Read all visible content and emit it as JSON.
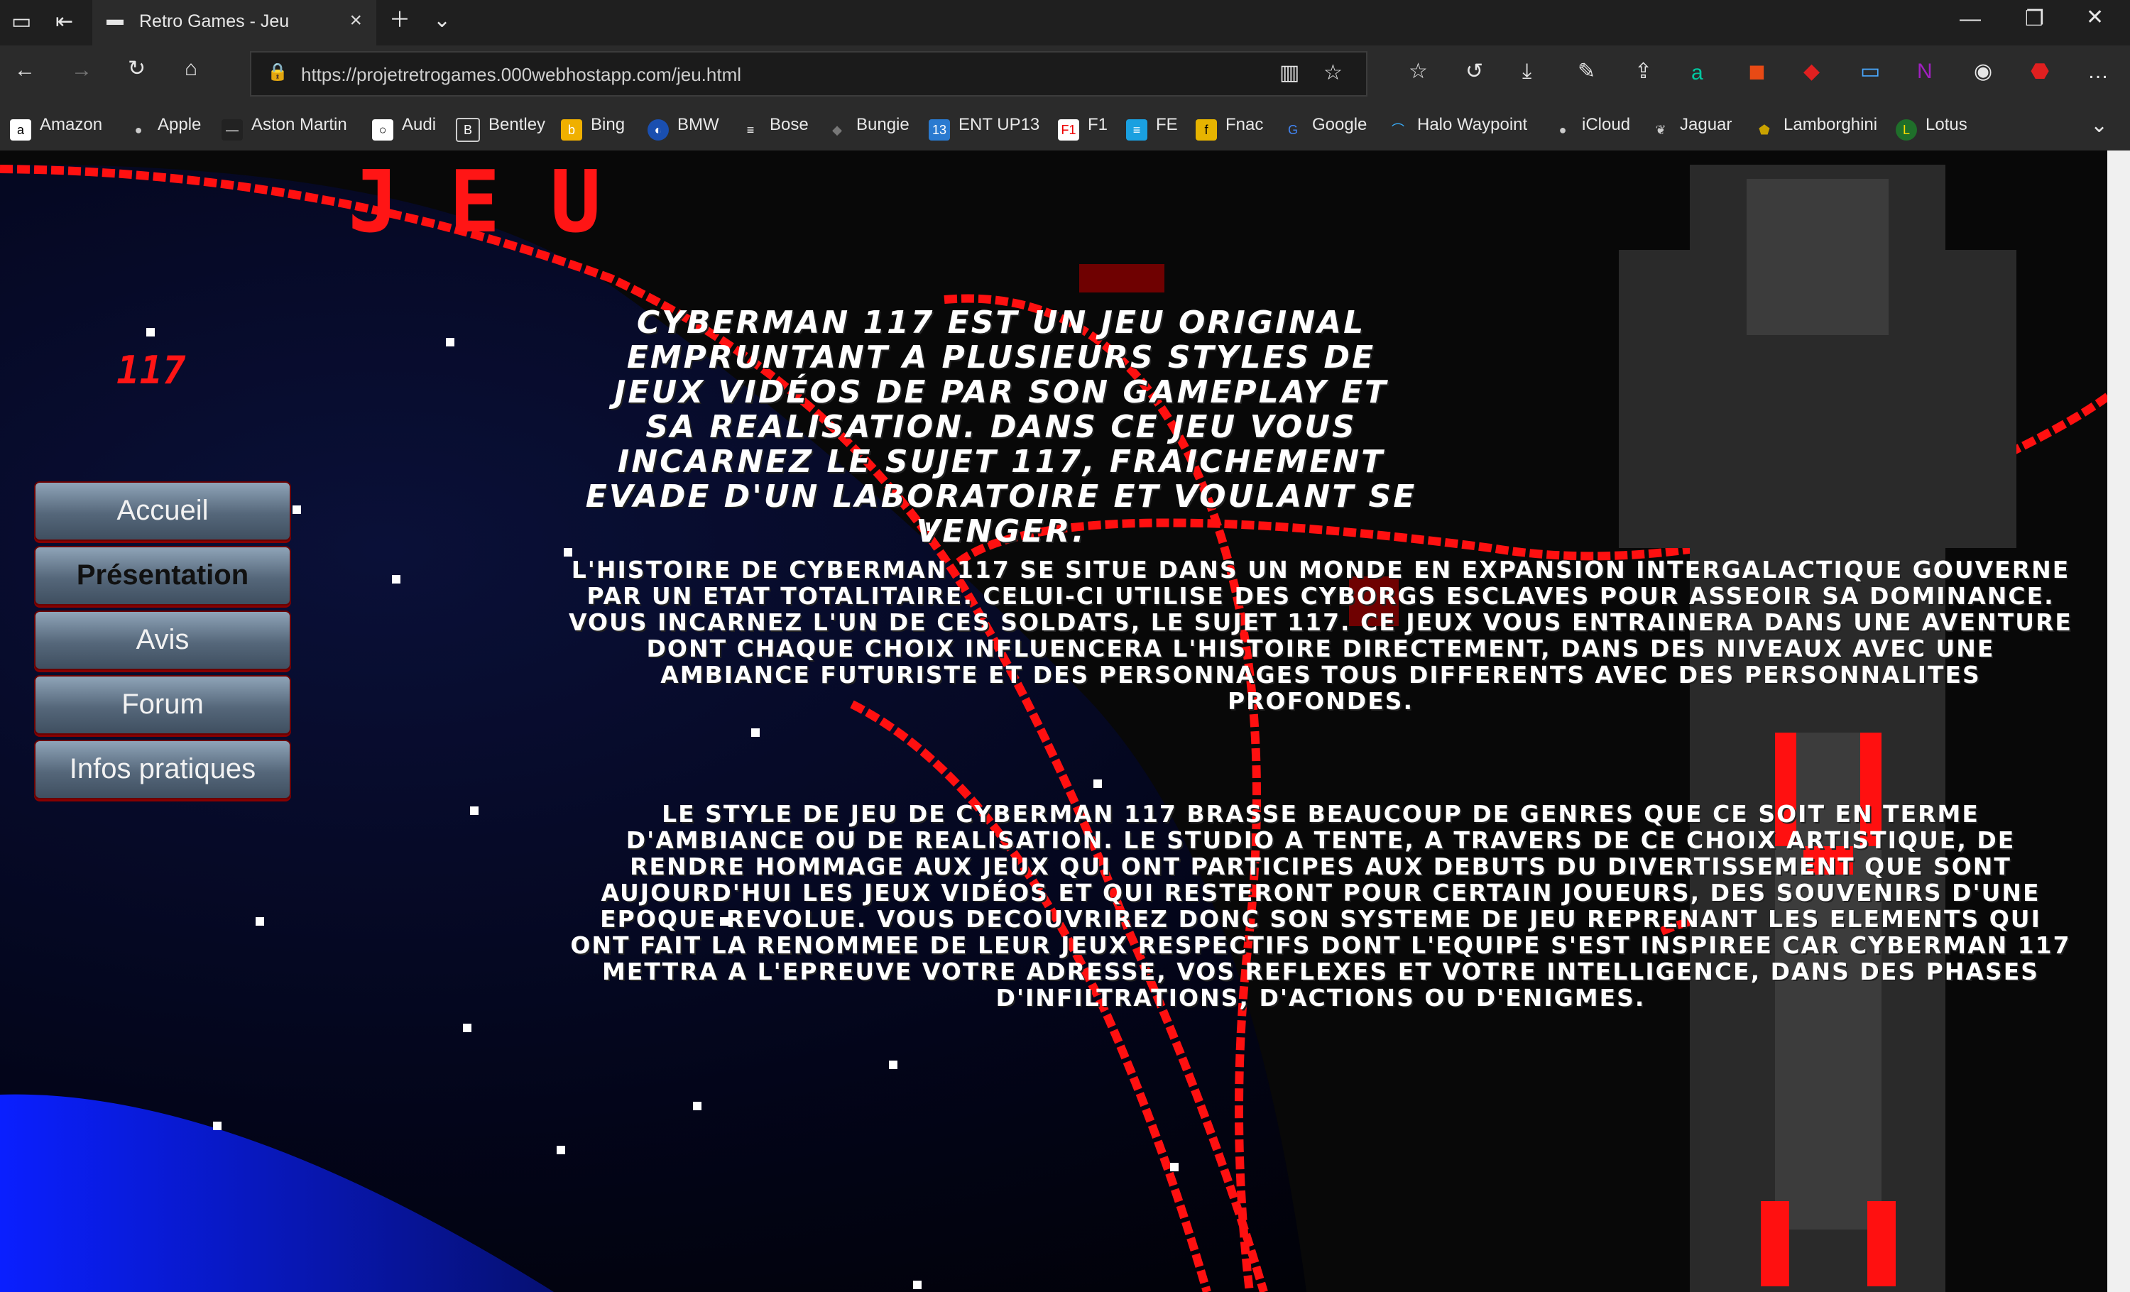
{
  "browser": {
    "tab_title": "Retro Games - Jeu",
    "url": "https://projetretrogames.000webhostapp.com/jeu.html",
    "bookmarks": [
      "Amazon",
      "Apple",
      "Aston Martin",
      "Audi",
      "Bentley",
      "Bing",
      "BMW",
      "Bose",
      "Bungie",
      "ENT UP13",
      "F1",
      "FE",
      "Fnac",
      "Google",
      "Halo Waypoint",
      "iCloud",
      "Jaguar",
      "Lamborghini",
      "Lotus"
    ]
  },
  "page": {
    "title": "JEU",
    "subtitle": "117",
    "menu": [
      "Accueil",
      "Présentation",
      "Avis",
      "Forum",
      "Infos pratiques"
    ],
    "intro": "Cyberman 117 est un jeu original empruntant a plusieurs styles de jeux vidéos de par son gameplay et sa realisation. Dans ce jeu vous incarnez le sujet 117, fraichement evade d'un laboratoire et voulant se venger.",
    "story": "L'histoire de Cyberman 117 se situe dans un monde en expansion intergalactique gouverne par un etat totalitaire. Celui-ci utilise des cyborgs esclaves pour asseoir sa dominance. Vous incarnez l'un de ces soldats, le sujet 117. Ce jeux vous entrainera dans une aventure dont chaque choix influencera l'histoire directement, dans des niveaux avec une ambiance futuriste et des personnages tous differents avec des personnalites profondes.",
    "style": "Le style de jeu de Cyberman 117 brasse beaucoup de genres que ce soit en terme d'ambiance ou de realisation. Le studio a tente, a travers de ce choix artistique, de rendre hommage aux jeux qui ont participes aux debuts du divertissement que sont aujourd'hui les jeux vidéos et qui resteront pour certain joueurs, des souvenirs d'une epoque revolue. Vous decouvrirez donc son systeme de jeu reprenant les elements qui ont fait la renommee de leur jeux respectifs dont l'equipe s'est inspiree car Cyberman 117 mettra a l'epreuve votre adresse, vos reflexes et votre intelligence, dans des phases d'infiltrations, d'actions ou d'enigmes."
  },
  "colors": {
    "accent": "#ff1515",
    "planet": "#1428ff"
  }
}
